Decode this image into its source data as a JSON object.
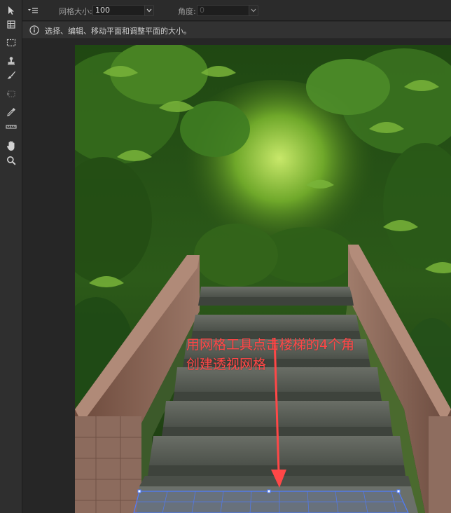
{
  "options_bar": {
    "grid_size_label": "网格大小:",
    "grid_size_value": "100",
    "angle_label": "角度:",
    "angle_value": "0"
  },
  "hint": {
    "text": "选择、编辑、移动平面和调整平面的大小。"
  },
  "annotation": {
    "line1": "用网格工具点击楼梯的4个角",
    "line2": "创建透视网格"
  },
  "colors": {
    "annotation": "#ff4747",
    "perspective_grid": "#4f7cff"
  },
  "tools": [
    "edit-plane-tool-icon",
    "create-plane-tool-icon",
    "marquee-tool-icon",
    "stamp-tool-icon",
    "brush-tool-icon",
    "transform-tool-icon",
    "eyedropper-tool-icon",
    "measure-tool-icon",
    "hand-tool-icon",
    "zoom-tool-icon"
  ]
}
